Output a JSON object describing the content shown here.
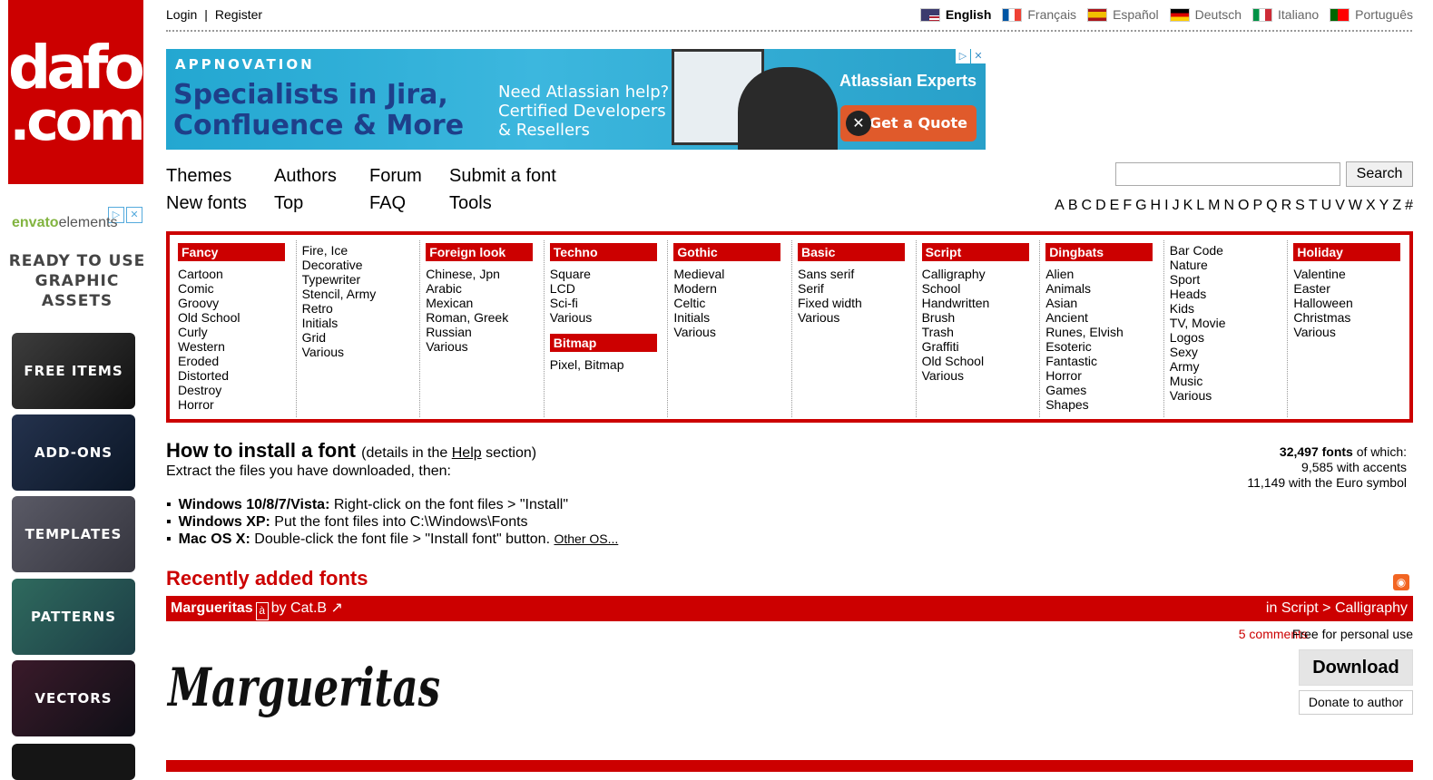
{
  "logo": {
    "line1": "dafont",
    "line2": ".com"
  },
  "left_ad": {
    "brand": "envato",
    "brand_suffix": "elements",
    "tagline": "READY TO USE GRAPHIC ASSETS",
    "tiles": [
      "FREE ITEMS",
      "ADD-ONS",
      "TEMPLATES",
      "PATTERNS",
      "VECTORS"
    ],
    "ad_close": "✕",
    "ad_choice": "▷"
  },
  "topbar": {
    "login": "Login",
    "separator": "|",
    "register": "Register",
    "languages": [
      {
        "label": "English",
        "active": true,
        "colors": [
          "#b22234",
          "#ffffff",
          "#3c3b6e"
        ]
      },
      {
        "label": "Français",
        "active": false,
        "colors": [
          "#0055a4",
          "#ffffff",
          "#ef4135"
        ]
      },
      {
        "label": "Español",
        "active": false,
        "colors": [
          "#aa151b",
          "#f1bf00",
          "#aa151b"
        ]
      },
      {
        "label": "Deutsch",
        "active": false,
        "colors": [
          "#000000",
          "#dd0000",
          "#ffce00"
        ]
      },
      {
        "label": "Italiano",
        "active": false,
        "colors": [
          "#009246",
          "#ffffff",
          "#ce2b37"
        ]
      },
      {
        "label": "Português",
        "active": false,
        "colors": [
          "#006600",
          "#ff0000",
          "#ff0000"
        ]
      }
    ]
  },
  "banner": {
    "brand": "APPNOVATION",
    "headline1": "Specialists in Jira,",
    "headline2": "Confluence & More",
    "sub1": "Need Atlassian help?",
    "sub2": "Certified Developers",
    "sub3": "& Resellers",
    "badge": "Atlassian Experts",
    "cta": "Get a Quote"
  },
  "nav": {
    "themes": "Themes",
    "authors": "Authors",
    "forum": "Forum",
    "submit": "Submit a font",
    "new_fonts": "New fonts",
    "top": "Top",
    "faq": "FAQ",
    "tools": "Tools",
    "search_button": "Search",
    "search_value": "",
    "alphabet": [
      "A",
      "B",
      "C",
      "D",
      "E",
      "F",
      "G",
      "H",
      "I",
      "J",
      "K",
      "L",
      "M",
      "N",
      "O",
      "P",
      "Q",
      "R",
      "S",
      "T",
      "U",
      "V",
      "W",
      "X",
      "Y",
      "Z",
      "#"
    ]
  },
  "categories": [
    {
      "title": "Fancy",
      "items": [
        "Cartoon",
        "Comic",
        "Groovy",
        "Old School",
        "Curly",
        "Western",
        "Eroded",
        "Distorted",
        "Destroy",
        "Horror"
      ]
    },
    {
      "title": "",
      "items": [
        "Fire, Ice",
        "Decorative",
        "Typewriter",
        "Stencil, Army",
        "Retro",
        "Initials",
        "Grid",
        "Various"
      ]
    },
    {
      "title": "Foreign look",
      "items": [
        "Chinese, Jpn",
        "Arabic",
        "Mexican",
        "Roman, Greek",
        "Russian",
        "Various"
      ]
    },
    {
      "title": "Techno",
      "items": [
        "Square",
        "LCD",
        "Sci-fi",
        "Various"
      ],
      "title2": "Bitmap",
      "items2": [
        "Pixel, Bitmap"
      ]
    },
    {
      "title": "Gothic",
      "items": [
        "Medieval",
        "Modern",
        "Celtic",
        "Initials",
        "Various"
      ]
    },
    {
      "title": "Basic",
      "items": [
        "Sans serif",
        "Serif",
        "Fixed width",
        "Various"
      ]
    },
    {
      "title": "Script",
      "items": [
        "Calligraphy",
        "School",
        "Handwritten",
        "Brush",
        "Trash",
        "Graffiti",
        "Old School",
        "Various"
      ]
    },
    {
      "title": "Dingbats",
      "items": [
        "Alien",
        "Animals",
        "Asian",
        "Ancient",
        "Runes, Elvish",
        "Esoteric",
        "Fantastic",
        "Horror",
        "Games",
        "Shapes"
      ]
    },
    {
      "title": "",
      "items": [
        "Bar Code",
        "Nature",
        "Sport",
        "Heads",
        "Kids",
        "TV, Movie",
        "Logos",
        "Sexy",
        "Army",
        "Music",
        "Various"
      ]
    },
    {
      "title": "Holiday",
      "items": [
        "Valentine",
        "Easter",
        "Halloween",
        "Christmas",
        "Various"
      ]
    }
  ],
  "install": {
    "title": "How to install a font",
    "detail_pre": "(details in the ",
    "detail_link": "Help",
    "detail_post": " section)",
    "extract": "Extract the files you have downloaded, then:",
    "os": [
      {
        "name": "Windows 10/8/7/Vista:",
        "text": " Right-click on the font files > \"Install\""
      },
      {
        "name": "Windows XP:",
        "text": " Put the font files into C:\\Windows\\Fonts"
      },
      {
        "name": "Mac OS X:",
        "text": " Double-click the font file > \"Install font\" button. ",
        "link": "Other OS..."
      }
    ]
  },
  "stats": {
    "total": "32,497 fonts",
    "total_suffix": " of which:",
    "accents": "9,585 with accents",
    "euro": "11,149 with the Euro symbol"
  },
  "recent": {
    "title": "Recently added fonts",
    "font_name": "Marguerita s",
    "font_name_text": "Margueritas",
    "accent_badge": "à",
    "by": "by Cat.B",
    "link_icon": "↗",
    "category": "in Script > Calligraphy",
    "comments": "5 comments",
    "license": "Free for personal use",
    "download": "Download",
    "donate": "Donate to author",
    "preview_text": "Margueritas"
  }
}
